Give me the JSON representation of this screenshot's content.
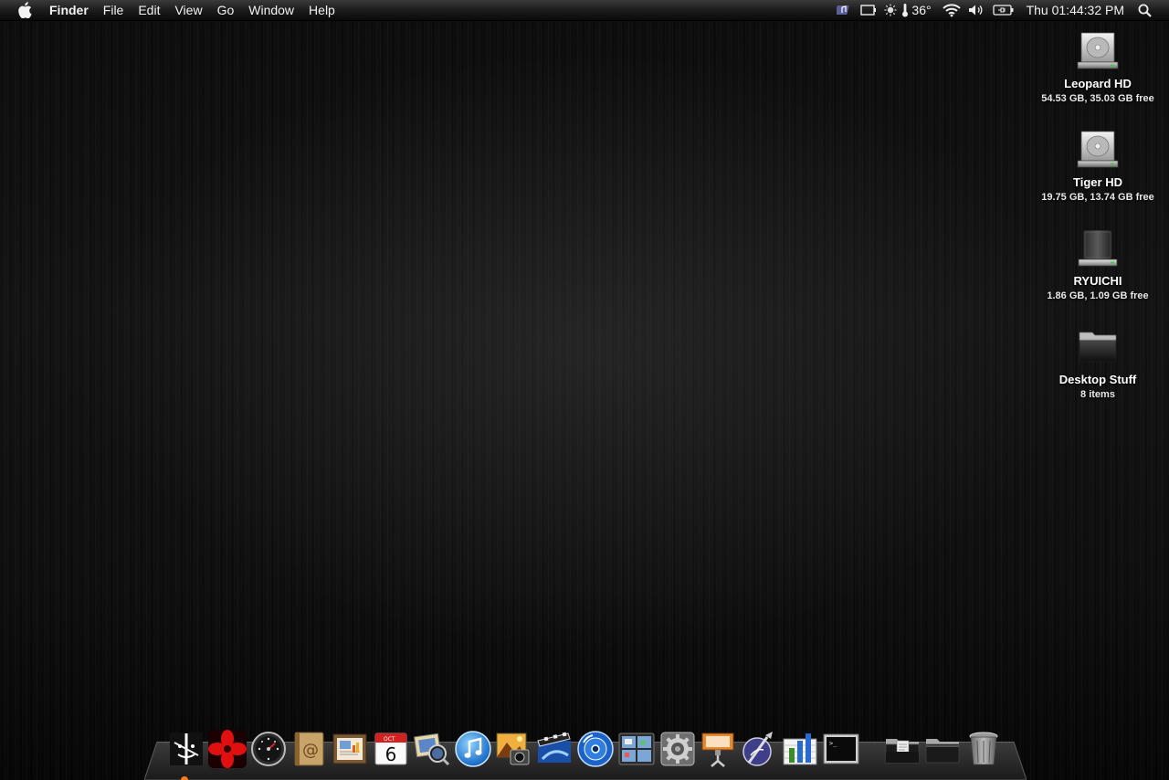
{
  "menubar": {
    "app_name": "Finder",
    "menus": [
      "File",
      "Edit",
      "View",
      "Go",
      "Window",
      "Help"
    ],
    "status_icons": [
      "itunes-notes-icon",
      "display-icon",
      "weather-sun-icon",
      "thermometer-icon",
      "wifi-icon",
      "volume-icon",
      "battery-plug-icon",
      "spotlight-search-icon"
    ],
    "temperature": "36°",
    "clock": "Thu 01:44:32 PM"
  },
  "desktop": {
    "icons": [
      {
        "name": "Leopard HD",
        "info": "54.53 GB, 35.03 GB free",
        "icon": "hard-drive-icon"
      },
      {
        "name": "Tiger HD",
        "info": "19.75 GB, 13.74 GB free",
        "icon": "hard-drive-icon"
      },
      {
        "name": "RYUICHI",
        "info": "1.86 GB, 1.09 GB free",
        "icon": "external-drive-icon"
      },
      {
        "name": "Desktop Stuff",
        "info": "8 items",
        "icon": "folder-icon"
      }
    ]
  },
  "dock": {
    "apps": [
      "finder",
      "fan-control",
      "dashboard",
      "address-book",
      "preview",
      "ical",
      "iphoto-loupe",
      "itunes",
      "iphoto",
      "imovie",
      "dvd-player",
      "spaces",
      "system-preferences",
      "keynote",
      "script-editor",
      "numbers",
      "terminal"
    ],
    "stacks": [
      "documents-stack",
      "downloads-stack",
      "trash"
    ],
    "ical_date": "6",
    "ical_month": "OCT",
    "colors": {
      "accent_running": "#ff7a1a",
      "menubar_top": "#3a3a3a",
      "menubar_bottom": "#0a0a0a"
    }
  }
}
